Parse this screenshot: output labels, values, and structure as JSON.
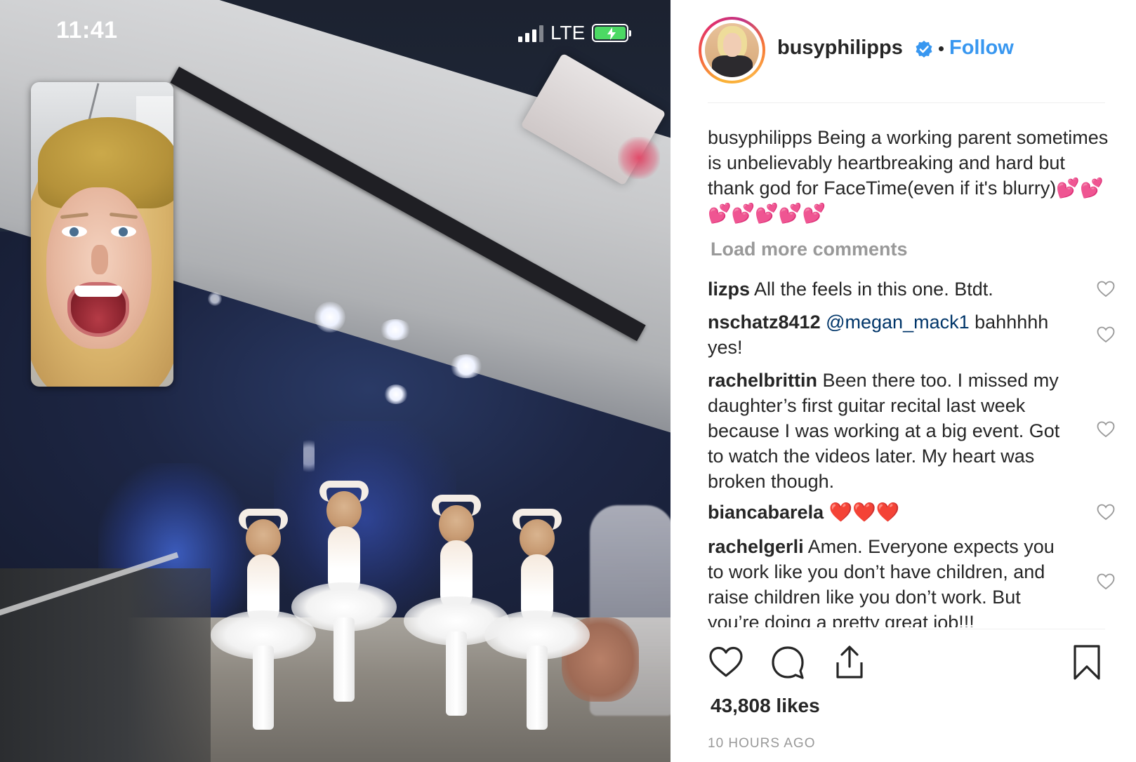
{
  "status_bar": {
    "time": "11:41",
    "network": "LTE",
    "icons": [
      "signal-bars-icon",
      "battery-charging-icon"
    ]
  },
  "post": {
    "username": "busyphilipps",
    "verified": true,
    "follow_label": "Follow",
    "caption": {
      "user": "busyphilipps",
      "text": "Being a working parent sometimes is unbelievably heartbreaking and hard but thank god for FaceTime(even if it's blurry)",
      "emojis": "💕💕💕💕💕💕💕"
    },
    "load_more_label": "Load more comments",
    "comments": [
      {
        "user": "lizps",
        "mention": "",
        "text": "All the feels in this one. Btdt."
      },
      {
        "user": "nschatz8412",
        "mention": "@megan_mack1",
        "text": "bahhhhh yes!"
      },
      {
        "user": "rachelbrittin",
        "mention": "",
        "text": "Been there too. I missed my daughter’s first guitar recital last week because I was working at a big event. Got to watch the videos later. My heart was broken though."
      },
      {
        "user": "biancabarela",
        "mention": "",
        "text": "❤️❤️❤️"
      },
      {
        "user": "rachelgerli",
        "mention": "",
        "text": "Amen. Everyone expects you to work like you don’t have children, and raise children like you don’t work. But you’re doing a pretty great job!!!"
      }
    ],
    "likes": "43,808 likes",
    "time_ago": "10 HOURS AGO"
  },
  "colors": {
    "link_blue": "#3897f0",
    "mention_blue": "#003569",
    "text": "#262626",
    "muted": "#999999",
    "battery_green": "#4cd964"
  }
}
